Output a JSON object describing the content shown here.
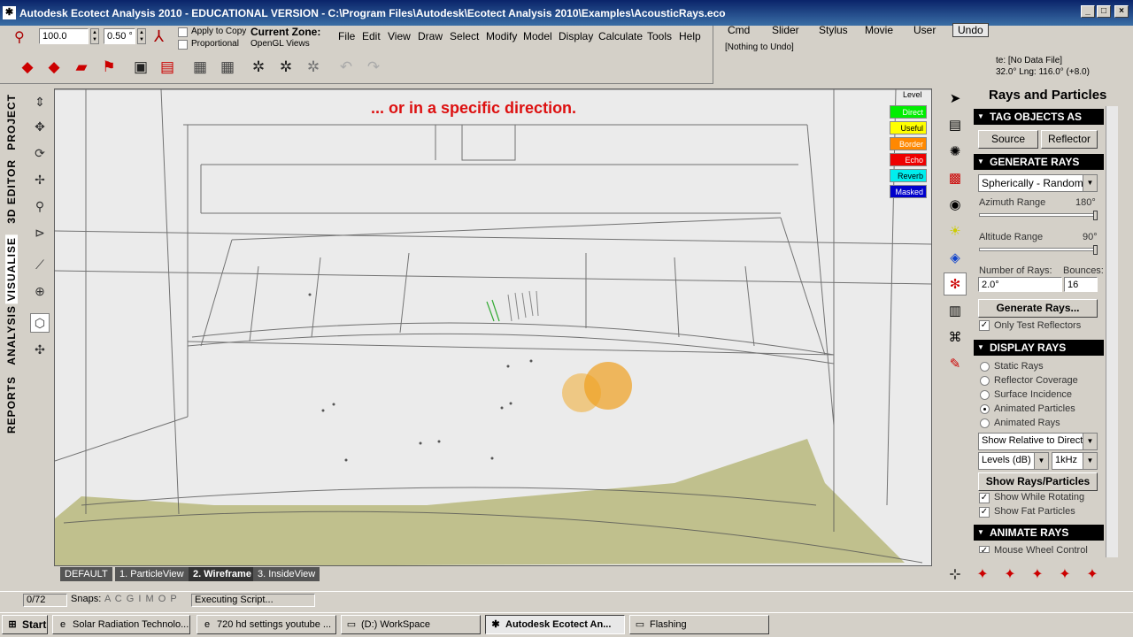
{
  "window": {
    "title": "Autodesk Ecotect Analysis 2010 - EDUCATIONAL VERSION - C:\\Program Files\\Autodesk\\Ecotect Analysis 2010\\Examples\\AcousticRays.eco",
    "controls": [
      "_",
      "□",
      "×"
    ]
  },
  "toolbar": {
    "scale_value": "100.0",
    "step_value": "0.50 °",
    "apply_to_copy": "Apply to Copy",
    "proportional": "Proportional",
    "current_zone_label": "Current Zone:",
    "current_zone_value": "OpenGL Views"
  },
  "menu": {
    "items": [
      "File",
      "Edit",
      "View",
      "Draw",
      "Select",
      "Modify",
      "Model",
      "Display",
      "Calculate",
      "Tools",
      "Help"
    ]
  },
  "cmd_panel": {
    "tabs": [
      "Cmd",
      "Slider",
      "Stylus",
      "Movie",
      "User",
      "Undo"
    ],
    "undo_text": "[Nothing to Undo]",
    "data_file": "te: [No Data File]",
    "coords": "32.0°  Lng: 116.0° (+8.0)"
  },
  "left_tabs": [
    "PROJECT",
    "3D EDITOR",
    "VISUALISE",
    "ANALYSIS",
    "REPORTS"
  ],
  "viewport": {
    "caption": "... or in a specific direction.",
    "legend_title": "Level",
    "legend": [
      {
        "label": "Direct",
        "color": "#00ee00",
        "text": "#ffffff"
      },
      {
        "label": "Useful",
        "color": "#ffff00",
        "text": "#000000"
      },
      {
        "label": "Border",
        "color": "#ff8800",
        "text": "#ffffff"
      },
      {
        "label": "Echo",
        "color": "#ee0000",
        "text": "#ffffff"
      },
      {
        "label": "Reverb",
        "color": "#00eeee",
        "text": "#000000"
      },
      {
        "label": "Masked",
        "color": "#0000cc",
        "text": "#ffffff"
      }
    ],
    "view_tabs": [
      "DEFAULT",
      "1. ParticleView",
      "2. Wireframe",
      "3. InsideView"
    ]
  },
  "side_panel": {
    "title": "Rays and Particles",
    "tag_section": "TAG OBJECTS AS",
    "source_btn": "Source",
    "reflector_btn": "Reflector",
    "generate_section": "GENERATE RAYS",
    "generation_mode": "Spherically - Random",
    "azimuth_label": "Azimuth Range",
    "azimuth_value": "180°",
    "altitude_label": "Altitude Range",
    "altitude_value": "90°",
    "num_rays_label": "Number of Rays:",
    "bounces_label": "Bounces:",
    "num_rays_value": "2.0°",
    "bounces_value": "16",
    "generate_btn": "Generate Rays...",
    "only_test_reflectors": "Only Test Reflectors",
    "display_section": "DISPLAY RAYS",
    "display_options": [
      "Static Rays",
      "Reflector Coverage",
      "Surface Incidence",
      "Animated Particles",
      "Animated Rays"
    ],
    "display_selected": "Animated Particles",
    "relative_mode": "Show Relative to Direct",
    "levels_mode": "Levels (dB)",
    "frequency": "1kHz",
    "show_btn": "Show Rays/Particles",
    "show_while_rotating": "Show While Rotating",
    "show_fat_particles": "Show Fat Particles",
    "animate_section": "ANIMATE RAYS",
    "mouse_wheel": "Mouse Wheel Control"
  },
  "status": {
    "count": "0/72",
    "snaps_label": "Snaps:",
    "snaps_letters": "A C G I   M O P",
    "message": "Executing Script..."
  },
  "taskbar": {
    "start": "Start",
    "tasks": [
      {
        "label": "Solar Radiation Technolo...",
        "icon": "e",
        "active": false
      },
      {
        "label": "720 hd settings youtube ...",
        "icon": "e",
        "active": false
      },
      {
        "label": "(D:) WorkSpace",
        "icon": "▭",
        "active": false
      },
      {
        "label": "Autodesk Ecotect An...",
        "icon": "✱",
        "active": true
      },
      {
        "label": "Flashing",
        "icon": "▭",
        "active": false
      }
    ]
  }
}
